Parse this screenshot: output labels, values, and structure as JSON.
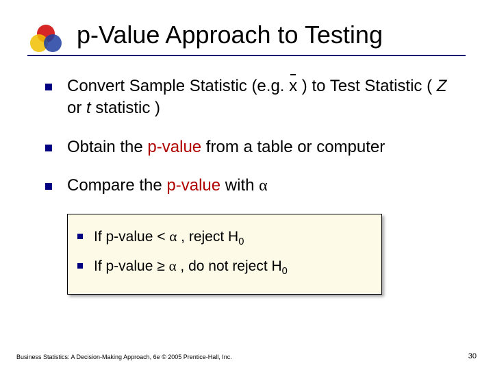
{
  "title": "p-Value Approach to Testing",
  "bullets": [
    {
      "pre": "Convert Sample Statistic (e.g. ",
      "xbar": "x",
      "post1": " ) to Test Statistic ( ",
      "z": "Z",
      "mid": " or ",
      "t": "t",
      "post2": "  statistic )"
    },
    {
      "pre": "Obtain the ",
      "pval": "p-value",
      "post": " from a table or computer"
    },
    {
      "pre": "Compare the ",
      "pval": "p-value",
      "post": " with  ",
      "alpha": "α"
    }
  ],
  "subbullets": [
    {
      "pre": "If   p-value  <  ",
      "alpha": "α",
      "post": " ,   reject H",
      "sub": "0"
    },
    {
      "pre": "If   p-value  ≥  ",
      "alpha": "α",
      "post": " ,   do not reject H",
      "sub": "0"
    }
  ],
  "footer_left": "Business Statistics: A Decision-Making Approach, 6e © 2005 Prentice-Hall, Inc.",
  "footer_right": "30"
}
